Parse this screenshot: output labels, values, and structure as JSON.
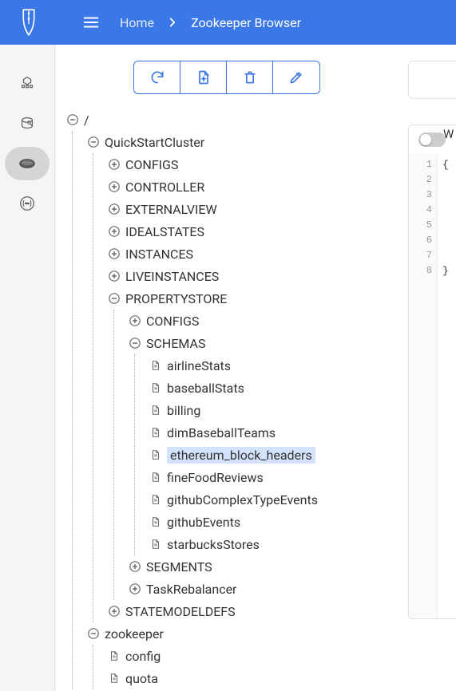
{
  "breadcrumb": {
    "home": "Home",
    "current": "Zookeeper Browser"
  },
  "sidebar_icons": [
    "cluster",
    "query",
    "zookeeper",
    "swagger"
  ],
  "sidebar_active_index": 2,
  "toolbar_icons": [
    "refresh",
    "add-file",
    "delete",
    "edit"
  ],
  "tree": {
    "root": "/",
    "clusters": [
      {
        "name": "QuickStartCluster",
        "expanded": true,
        "children": [
          {
            "name": "CONFIGS",
            "type": "folder",
            "expanded": false
          },
          {
            "name": "CONTROLLER",
            "type": "folder",
            "expanded": false
          },
          {
            "name": "EXTERNALVIEW",
            "type": "folder",
            "expanded": false
          },
          {
            "name": "IDEALSTATES",
            "type": "folder",
            "expanded": false
          },
          {
            "name": "INSTANCES",
            "type": "folder",
            "expanded": false
          },
          {
            "name": "LIVEINSTANCES",
            "type": "folder",
            "expanded": false
          },
          {
            "name": "PROPERTYSTORE",
            "type": "folder",
            "expanded": true,
            "children": [
              {
                "name": "CONFIGS",
                "type": "folder",
                "expanded": false
              },
              {
                "name": "SCHEMAS",
                "type": "folder",
                "expanded": true,
                "children": [
                  {
                    "name": "airlineStats",
                    "type": "file"
                  },
                  {
                    "name": "baseballStats",
                    "type": "file"
                  },
                  {
                    "name": "billing",
                    "type": "file"
                  },
                  {
                    "name": "dimBaseballTeams",
                    "type": "file"
                  },
                  {
                    "name": "ethereum_block_headers",
                    "type": "file",
                    "selected": true
                  },
                  {
                    "name": "fineFoodReviews",
                    "type": "file"
                  },
                  {
                    "name": "githubComplexTypeEvents",
                    "type": "file"
                  },
                  {
                    "name": "githubEvents",
                    "type": "file"
                  },
                  {
                    "name": "starbucksStores",
                    "type": "file"
                  }
                ]
              },
              {
                "name": "SEGMENTS",
                "type": "folder",
                "expanded": false
              },
              {
                "name": "TaskRebalancer",
                "type": "folder",
                "expanded": false
              }
            ]
          },
          {
            "name": "STATEMODELDEFS",
            "type": "folder",
            "expanded": false
          }
        ]
      },
      {
        "name": "zookeeper",
        "expanded": true,
        "children": [
          {
            "name": "config",
            "type": "file"
          },
          {
            "name": "quota",
            "type": "file"
          }
        ]
      }
    ]
  },
  "right": {
    "partial_label": "W",
    "code_lines": [
      "1",
      "2",
      "3",
      "4",
      "5",
      "6",
      "7",
      "8"
    ],
    "code_brace_open": "{",
    "code_brace_close": "}"
  }
}
